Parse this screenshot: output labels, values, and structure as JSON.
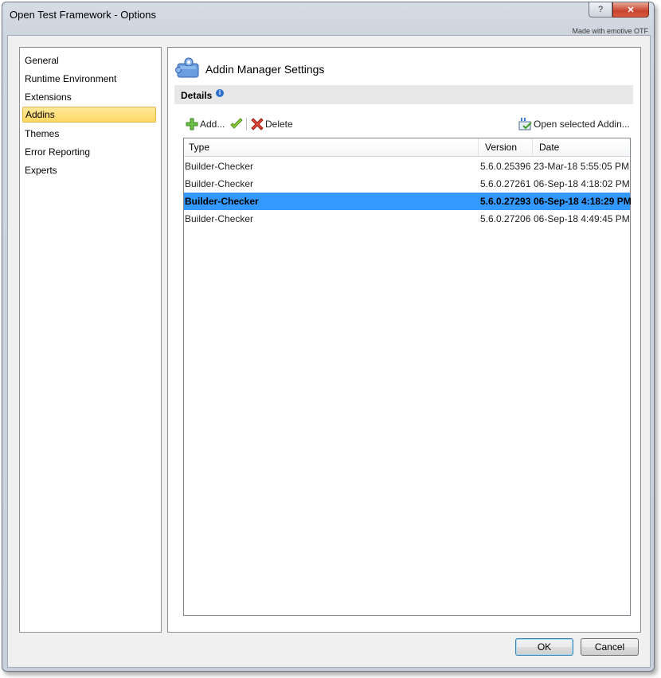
{
  "window": {
    "title": "Open Test Framework - Options",
    "help_label": "?",
    "close_label": "✕",
    "made_with": "Made with emotive OTF"
  },
  "sidebar": {
    "items": [
      {
        "label": "General"
      },
      {
        "label": "Runtime Environment"
      },
      {
        "label": "Extensions"
      },
      {
        "label": "Addins",
        "selected": true
      },
      {
        "label": "Themes"
      },
      {
        "label": "Error Reporting"
      },
      {
        "label": "Experts"
      }
    ]
  },
  "main": {
    "title": "Addin Manager Settings",
    "details_label": "Details",
    "toolbar": {
      "add_label": "Add...",
      "delete_label": "Delete",
      "open_label": "Open selected Addin..."
    },
    "table": {
      "columns": [
        "Type",
        "Version",
        "Date"
      ],
      "rows": [
        {
          "type": "Builder-Checker",
          "version": "5.6.0.25396",
          "date": "23-Mar-18 5:55:05 PM",
          "selected": false
        },
        {
          "type": "Builder-Checker",
          "version": "5.6.0.27261",
          "date": "06-Sep-18 4:18:02 PM",
          "selected": false
        },
        {
          "type": "Builder-Checker",
          "version": "5.6.0.27293",
          "date": "06-Sep-18 4:18:29 PM",
          "selected": true
        },
        {
          "type": "Builder-Checker",
          "version": "5.6.0.27206",
          "date": "06-Sep-18 4:49:45 PM",
          "selected": false
        }
      ]
    }
  },
  "buttons": {
    "ok_label": "OK",
    "cancel_label": "Cancel"
  },
  "colors": {
    "selection": "#3399ff",
    "nav_selection": "#fdd863",
    "close_button": "#c7432c"
  }
}
